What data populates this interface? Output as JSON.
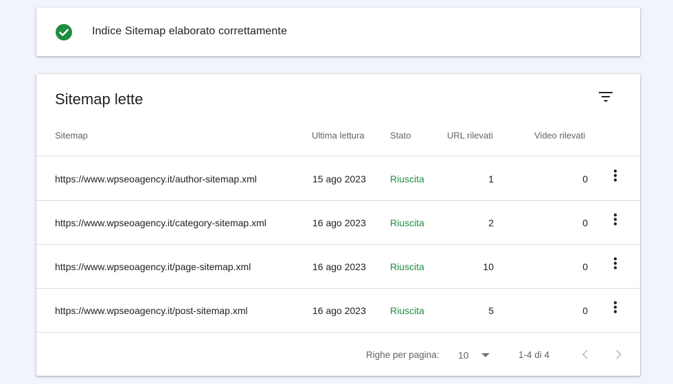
{
  "banner": {
    "message": "Indice Sitemap elaborato correttamente",
    "icon": "check-circle-icon",
    "icon_color": "#1e8e3e"
  },
  "table": {
    "title": "Sitemap lette",
    "filter_icon": "filter-icon",
    "headers": {
      "sitemap": "Sitemap",
      "last_read": "Ultima lettura",
      "status": "Stato",
      "urls": "URL rilevati",
      "videos": "Video rilevati"
    },
    "rows": [
      {
        "sitemap": "https://www.wpseoagency.it/author-sitemap.xml",
        "last_read": "15 ago 2023",
        "status": "Riuscita",
        "urls": "1",
        "videos": "0"
      },
      {
        "sitemap": "https://www.wpseoagency.it/category-sitemap.xml",
        "last_read": "16 ago 2023",
        "status": "Riuscita",
        "urls": "2",
        "videos": "0"
      },
      {
        "sitemap": "https://www.wpseoagency.it/page-sitemap.xml",
        "last_read": "16 ago 2023",
        "status": "Riuscita",
        "urls": "10",
        "videos": "0"
      },
      {
        "sitemap": "https://www.wpseoagency.it/post-sitemap.xml",
        "last_read": "16 ago 2023",
        "status": "Riuscita",
        "urls": "5",
        "videos": "0"
      }
    ],
    "status_color": "#1e8e3e"
  },
  "pagination": {
    "rows_per_page_label": "Righe per pagina:",
    "rows_per_page_value": "10",
    "range": "1-4 di 4"
  }
}
